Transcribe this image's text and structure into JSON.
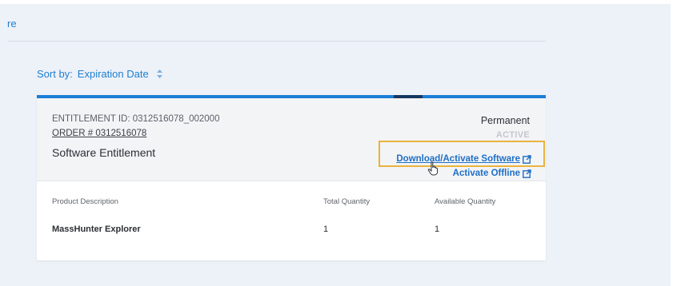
{
  "header": {
    "partial_link": "re"
  },
  "sort": {
    "label": "Sort by:",
    "value": "Expiration Date"
  },
  "entitlement": {
    "id_label": "ENTITLEMENT ID: 0312516078_002000",
    "order_label": "ORDER # 0312516078",
    "title": "Software Entitlement",
    "term": "Permanent",
    "status": "ACTIVE",
    "download_link": "Download/Activate Software",
    "offline_link": "Activate Offline"
  },
  "table": {
    "columns": [
      "Product Description",
      "Total Quantity",
      "Available Quantity"
    ],
    "rows": [
      [
        "MassHunter Explorer",
        "1",
        "1"
      ]
    ]
  },
  "colors": {
    "accent": "#1a7ed6",
    "accent_dark": "#16375f",
    "highlight": "#e9b33f",
    "panel_bg": "#edf1f8"
  }
}
